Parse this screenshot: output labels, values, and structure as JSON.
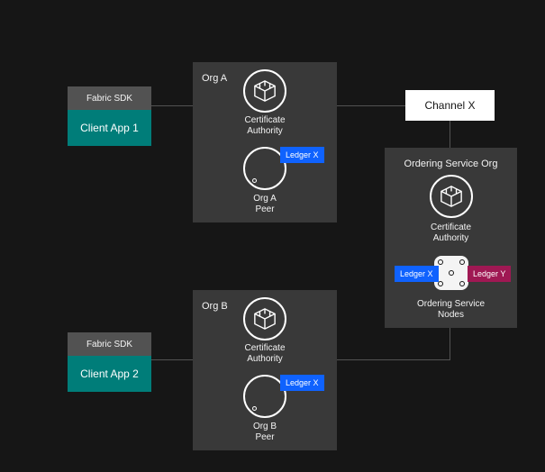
{
  "clients": [
    {
      "sdk_label": "Fabric SDK",
      "app_label": "Client App 1"
    },
    {
      "sdk_label": "Fabric SDK",
      "app_label": "Client App 2"
    }
  ],
  "org_a": {
    "title": "Org A",
    "ca_label_1": "Certificate",
    "ca_label_2": "Authority",
    "peer_label_1": "Org A",
    "peer_label_2": "Peer",
    "ledger_label": "Ledger X"
  },
  "org_b": {
    "title": "Org B",
    "ca_label_1": "Certificate",
    "ca_label_2": "Authority",
    "peer_label_1": "Org B",
    "peer_label_2": "Peer",
    "ledger_label": "Ledger X"
  },
  "channel": {
    "label": "Channel X"
  },
  "ordering_org": {
    "title": "Ordering Service Org",
    "ca_label_1": "Certificate",
    "ca_label_2": "Authority",
    "ledger_x": "Ledger X",
    "ledger_y": "Ledger Y",
    "node_label_1": "Ordering Service",
    "node_label_2": "Nodes"
  },
  "colors": {
    "bg": "#161616",
    "panel": "#393939",
    "muted": "#525252",
    "teal": "#007d79",
    "blue": "#0f62fe",
    "magenta": "#9f1853",
    "white": "#ffffff"
  }
}
